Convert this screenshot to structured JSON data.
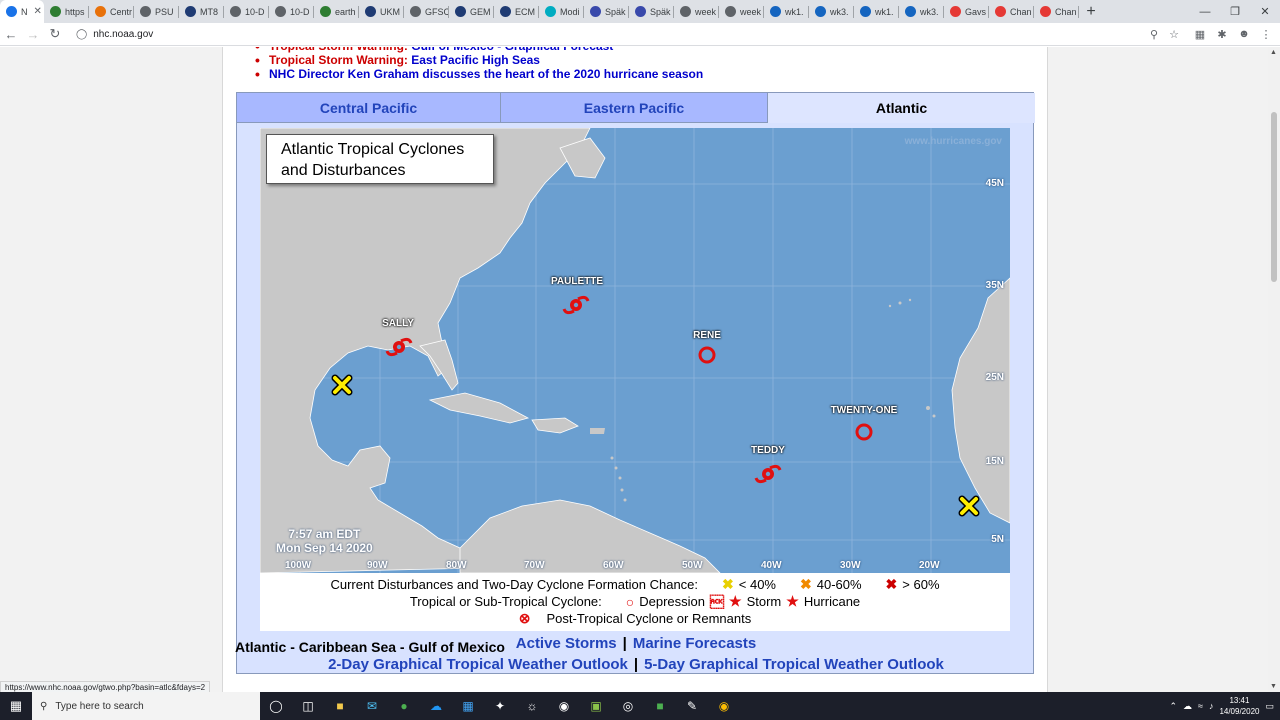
{
  "browser": {
    "tabs": [
      {
        "label": "N",
        "color": "#1a73e8",
        "active": true
      },
      {
        "label": "https",
        "color": "#2e7d32"
      },
      {
        "label": "Centr",
        "color": "#e8710a"
      },
      {
        "label": "PSU",
        "color": "#5f6368"
      },
      {
        "label": "MT8",
        "color": "#1f3b73"
      },
      {
        "label": "10-D",
        "color": "#5f6368"
      },
      {
        "label": "10-D",
        "color": "#5f6368"
      },
      {
        "label": "earth",
        "color": "#2e7d32"
      },
      {
        "label": "UKM",
        "color": "#1f3b73"
      },
      {
        "label": "GFSC",
        "color": "#5f6368"
      },
      {
        "label": "GEM",
        "color": "#1f3b73"
      },
      {
        "label": "ECM",
        "color": "#1f3b73"
      },
      {
        "label": "Modi",
        "color": "#00acc1"
      },
      {
        "label": "Späk",
        "color": "#3949ab"
      },
      {
        "label": "Späk",
        "color": "#3949ab"
      },
      {
        "label": "week",
        "color": "#5f6368"
      },
      {
        "label": "week",
        "color": "#5f6368"
      },
      {
        "label": "wk1.",
        "color": "#1565c0"
      },
      {
        "label": "wk3.",
        "color": "#1565c0"
      },
      {
        "label": "wk1.",
        "color": "#1565c0"
      },
      {
        "label": "wk3.",
        "color": "#1565c0"
      },
      {
        "label": "Gavs",
        "color": "#e53935"
      },
      {
        "label": "Chan",
        "color": "#e53935"
      },
      {
        "label": "Chan",
        "color": "#e53935"
      }
    ],
    "newtab": "+",
    "url": "nhc.noaa.gov",
    "status_url": "https://www.nhc.noaa.gov/gtwo.php?basin=atlc&fdays=2"
  },
  "news": [
    {
      "warn": "Tropical Storm Warning:",
      "link": "Gulf of Mexico - Graphical Forecast"
    },
    {
      "warn": "Tropical Storm Warning:",
      "link": "East Pacific High Seas"
    },
    {
      "warn": "",
      "link": "NHC Director Ken Graham discusses the heart of the 2020 hurricane season"
    }
  ],
  "basin_tabs": [
    {
      "label": "Central Pacific",
      "selected": false
    },
    {
      "label": "Eastern Pacific",
      "selected": false
    },
    {
      "label": "Atlantic",
      "selected": true
    }
  ],
  "map": {
    "title": "Atlantic Tropical Cyclones and Disturbances",
    "watermark": "www.hurricanes.gov",
    "lat_labels": [
      "45N",
      "35N",
      "25N",
      "15N",
      "5N"
    ],
    "lon_labels": [
      "100W",
      "90W",
      "80W",
      "70W",
      "60W",
      "50W",
      "40W",
      "30W",
      "20W"
    ],
    "time": "7:57 am EDT",
    "date": "Mon Sep 14 2020",
    "storms": [
      {
        "name": "PAULETTE",
        "kind": "hurricane"
      },
      {
        "name": "SALLY",
        "kind": "hurricane"
      },
      {
        "name": "RENE",
        "kind": "depression"
      },
      {
        "name": "TWENTY-ONE",
        "kind": "depression"
      },
      {
        "name": "TEDDY",
        "kind": "hurricane"
      }
    ],
    "colors": {
      "ocean": "#6b9fd0",
      "land": "#c8c8c8",
      "cyclone": "#e01010",
      "low_chance": "#ffee00"
    }
  },
  "legend": {
    "row1_label": "Current Disturbances and Two-Day Cyclone Formation Chance:",
    "low": "< 40%",
    "mid": "40-60%",
    "high": "> 60%",
    "row2_label": "Tropical or Sub-Tropical Cyclone:",
    "depression": "Depression",
    "storm": "Storm",
    "hurricane": "Hurricane",
    "row3_label": "Post-Tropical Cyclone or Remnants"
  },
  "links": {
    "active_storms": "Active Storms",
    "marine": "Marine Forecasts",
    "two_day": "2-Day Graphical Tropical Weather Outlook",
    "five_day": "5-Day Graphical Tropical Weather Outlook",
    "sep": "|"
  },
  "below_heading": "Atlantic - Caribbean Sea - Gulf of Mexico",
  "taskbar": {
    "search_placeholder": "Type here to search",
    "time": "13:41",
    "date": "14/09/2020"
  }
}
